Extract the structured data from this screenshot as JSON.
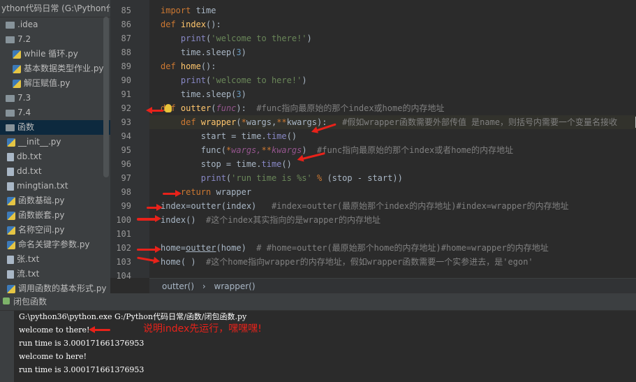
{
  "project": {
    "title": "ython代码日常 (G:\\Python代",
    "items": [
      {
        "label": ".idea",
        "kind": "folder"
      },
      {
        "label": "7.2",
        "kind": "folder"
      },
      {
        "label": "while 循环.py",
        "kind": "py"
      },
      {
        "label": "基本数据类型作业.py",
        "kind": "py"
      },
      {
        "label": "解压赋值.py",
        "kind": "py"
      },
      {
        "label": "7.3",
        "kind": "folder"
      },
      {
        "label": "7.4",
        "kind": "folder"
      },
      {
        "label": "函数",
        "kind": "folder"
      },
      {
        "label": "__init__.py",
        "kind": "py"
      },
      {
        "label": "db.txt",
        "kind": "txt"
      },
      {
        "label": "dd.txt",
        "kind": "txt"
      },
      {
        "label": "mingtian.txt",
        "kind": "txt"
      },
      {
        "label": "函数基础.py",
        "kind": "py"
      },
      {
        "label": "函数嵌套.py",
        "kind": "py"
      },
      {
        "label": "名称空间.py",
        "kind": "py"
      },
      {
        "label": "命名关键字参数.py",
        "kind": "py"
      },
      {
        "label": "张.txt",
        "kind": "txt"
      },
      {
        "label": "流.txt",
        "kind": "txt"
      },
      {
        "label": "调用函数的基本形式.py",
        "kind": "py"
      }
    ]
  },
  "editor": {
    "line_numbers": [
      "85",
      "86",
      "87",
      "88",
      "89",
      "90",
      "91",
      "92",
      "93",
      "94",
      "95",
      "96",
      "97",
      "98",
      "99",
      "100",
      "101",
      "102",
      "103",
      "104"
    ],
    "lines": {
      "l85_kw": "import",
      "l85_rest": " time",
      "l86_kw": "def",
      "l86_fn": " index",
      "l86_rest": "():",
      "l87_bi": "    print",
      "l87_p": "(",
      "l87_st": "'welcome to there!'",
      "l87_e": ")",
      "l88_a": "    time.",
      "l88_f": "sleep",
      "l88_b": "(",
      "l88_n": "3",
      "l88_c": ")",
      "l89_kw": "def",
      "l89_fn": " home",
      "l89_rest": "():",
      "l90_bi": "    print",
      "l90_p": "(",
      "l90_st": "'welcome to here!'",
      "l90_e": ")",
      "l91_a": "    time.",
      "l91_f": "sleep",
      "l91_b": "(",
      "l91_n": "3",
      "l91_c": ")",
      "l92_kw": "def",
      "l92_fn": " outter",
      "l92_a": "(",
      "l92_p": "func",
      "l92_b": "):  ",
      "l92_cm": "#func指向最原始的那个index或home的内存地址",
      "l93_kw": "    def",
      "l93_fn": " wrapper",
      "l93_a": "(",
      "l93_s1": "*",
      "l93_w": "wargs,",
      "l93_s2": "**",
      "l93_k": "kwargs",
      "l93_b": "):   ",
      "l93_cm": "#假如wrapper函数需要外部传值 是name，则括号内需要一个变量名接收",
      "l94_a": "        start = time.",
      "l94_f": "time",
      "l94_b": "()",
      "l95_a": "        func(",
      "l95_s1": "*",
      "l95_w": "wargs,",
      "l95_s2": "**",
      "l95_k": "kwargs",
      "l95_b": ")  ",
      "l95_cm": "#func指向最原始的那个index或者home的内存地址",
      "l96_a": "        stop = time.",
      "l96_f": "time",
      "l96_b": "()",
      "l97_bi": "        print",
      "l97_p": "(",
      "l97_st": "'run time is %s'",
      "l97_m": " % ",
      "l97_e": "(stop - start))",
      "l98_kw": "    return",
      "l98_rest": " wrapper",
      "l99_a": "index=outter(index)   ",
      "l99_cm": "#index=outter(最原始那个index的内存地址)#index=wrapper的内存地址",
      "l100_a": "index()  ",
      "l100_cm": "#这个index其实指向的是wrapper的内存地址",
      "l102_a": "home=",
      "l102_u": "outter",
      "l102_b": "(home)  ",
      "l102_cm": "# #home=outter(最原始那个home的内存地址)#home=wrapper的内存地址",
      "l103_a": "home( )  ",
      "l103_cm": "#这个home指向wrapper的内存地址，假如wrapper函数需要一个实参进去，是'egon'"
    }
  },
  "breadcrumb": {
    "first": "outter()",
    "sep": "›",
    "second": "wrapper()"
  },
  "run": {
    "tab_label": "闭包函数",
    "console": [
      "G:\\python36\\python.exe G:/Python代码日常/函数/闭包函数.py",
      "welcome to there!",
      "run time is 3.000171661376953",
      "welcome to here!",
      "run time is 3.000171661376953"
    ]
  },
  "annotation": "说明index先运行，嘿嘿嘿!",
  "colors": {
    "keyword": "#cc7832",
    "function": "#ffc66d",
    "string": "#6a8759",
    "comment": "#808080",
    "number": "#6897bb",
    "annotation": "#e8221a"
  }
}
